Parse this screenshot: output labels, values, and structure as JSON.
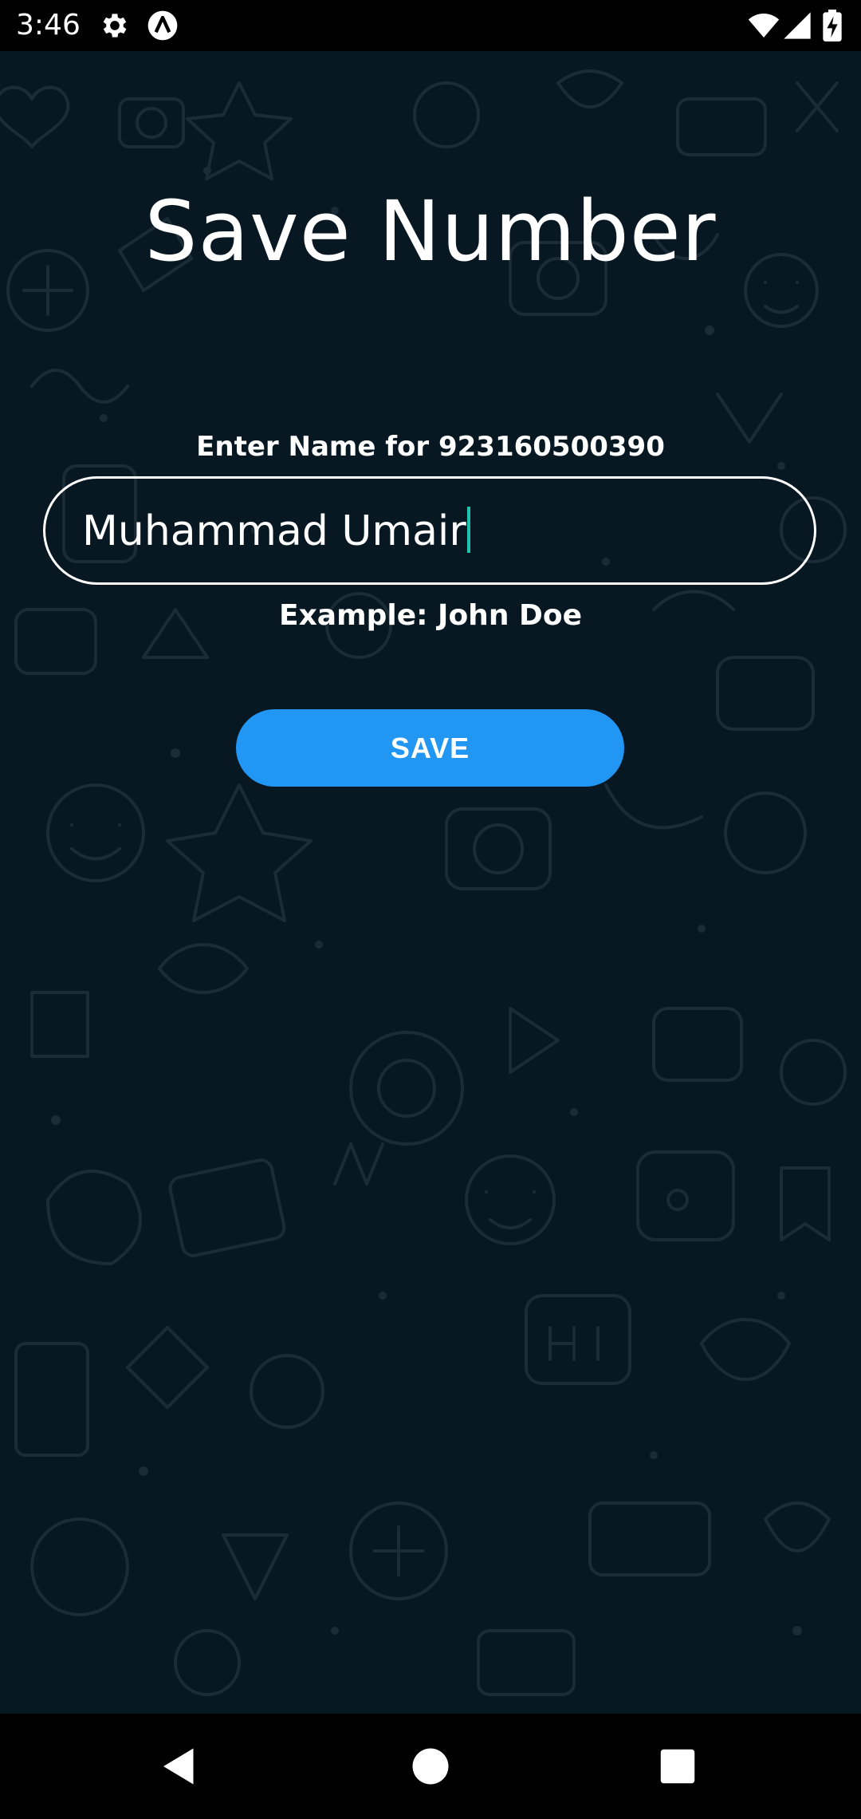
{
  "status_bar": {
    "time": "3:46",
    "icons": [
      "gear-icon",
      "app-a-icon",
      "wifi-icon",
      "signal-icon",
      "battery-charging-icon"
    ]
  },
  "screen": {
    "title": "Save Number",
    "label": "Enter Name for 923160500390",
    "input_value": "Muhammad Umair",
    "hint": "Example: John Doe",
    "save_label": "SAVE"
  },
  "nav_bar": {
    "buttons": [
      "back-icon",
      "home-icon",
      "recents-icon"
    ]
  },
  "colors": {
    "background": "#071823",
    "doodle": "#1b2c37",
    "button": "#2196f3",
    "caret": "#1ec3b0"
  }
}
